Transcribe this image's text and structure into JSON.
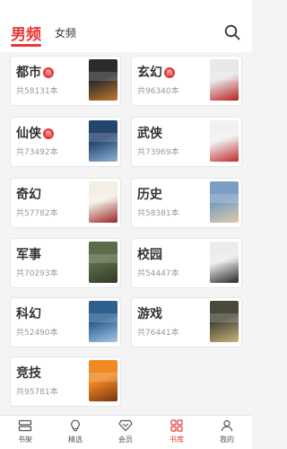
{
  "header": {
    "tabs": [
      {
        "label": "男频",
        "active": true
      },
      {
        "label": "女频",
        "active": false
      }
    ],
    "search_icon": "search-icon"
  },
  "categories": [
    {
      "name": "都市",
      "hot": true,
      "count": "共58131本",
      "cover_colors": [
        "#2b2b2b",
        "#c47a2c"
      ]
    },
    {
      "name": "玄幻",
      "hot": true,
      "count": "共96340本",
      "cover_colors": [
        "#e8e8e8",
        "#b81f1f"
      ]
    },
    {
      "name": "仙侠",
      "hot": true,
      "count": "共73492本",
      "cover_colors": [
        "#24456e",
        "#8fb4d6"
      ]
    },
    {
      "name": "武侠",
      "hot": false,
      "count": "共73969本",
      "cover_colors": [
        "#f1f1f1",
        "#c22a2a"
      ]
    },
    {
      "name": "奇幻",
      "hot": false,
      "count": "共57782本",
      "cover_colors": [
        "#f3efe6",
        "#9a2424"
      ]
    },
    {
      "name": "历史",
      "hot": false,
      "count": "共58381本",
      "cover_colors": [
        "#7a9fc4",
        "#e1c9a6"
      ]
    },
    {
      "name": "军事",
      "hot": false,
      "count": "共70293本",
      "cover_colors": [
        "#5c6b4a",
        "#2f3a26"
      ]
    },
    {
      "name": "校园",
      "hot": false,
      "count": "共54447本",
      "cover_colors": [
        "#ececec",
        "#262626"
      ]
    },
    {
      "name": "科幻",
      "hot": false,
      "count": "共52490本",
      "cover_colors": [
        "#2d5f8f",
        "#a7c8e6"
      ]
    },
    {
      "name": "游戏",
      "hot": false,
      "count": "共76441本",
      "cover_colors": [
        "#4a4a3a",
        "#c7b27a"
      ]
    },
    {
      "name": "竞技",
      "hot": false,
      "count": "共95781本",
      "cover_colors": [
        "#f08a24",
        "#7a3412"
      ]
    }
  ],
  "hot_badge": "热",
  "bottom_nav": [
    {
      "label": "书架",
      "icon": "bookshelf-icon",
      "active": false
    },
    {
      "label": "精选",
      "icon": "lightbulb-icon",
      "active": false
    },
    {
      "label": "会员",
      "icon": "vip-diamond-icon",
      "active": false
    },
    {
      "label": "书库",
      "icon": "grid-icon",
      "active": true
    },
    {
      "label": "我的",
      "icon": "user-icon",
      "active": false
    }
  ],
  "colors": {
    "accent": "#e53935",
    "background": "#f4f4f4"
  }
}
